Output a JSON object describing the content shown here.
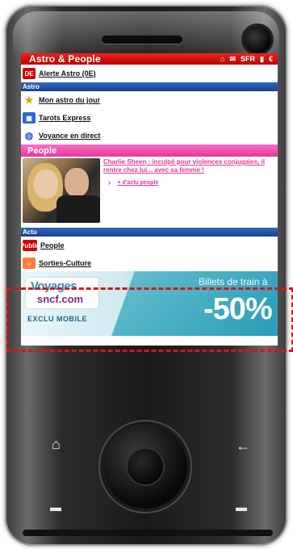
{
  "app": {
    "title": "Astro & People"
  },
  "status": {
    "network": "SFR",
    "euro": "€"
  },
  "alerte": {
    "label": "Alerte Astro (0E)",
    "badge": "DE"
  },
  "sections": {
    "astro": "Astro",
    "people": "People",
    "actu": "Actu"
  },
  "astro_items": [
    {
      "label": "Mon astro du jour",
      "icon": "stars-icon"
    },
    {
      "label": "Tarots Express",
      "icon": "cards-icon"
    },
    {
      "label": "Voyance en direct",
      "icon": "crystal-ball-icon"
    }
  ],
  "people": {
    "headline": "Charlie Sheen : inculpé pour violences conjugales, il rentre chez lui... avec sa femme !",
    "more_link": "+ d'actu people"
  },
  "actu_items": [
    {
      "label": "People",
      "badge": "Public"
    },
    {
      "label": "Sorties-Culture"
    }
  ],
  "ad": {
    "logo_top": "Voyages",
    "logo_bottom": "sncf.com",
    "exclu": "EXCLU MOBILE",
    "headline": "Billets de train à",
    "discount": "-50%"
  },
  "colors": {
    "topbar_red": "#d40000",
    "section_blue": "#1a3f8a",
    "people_pink": "#e2389a",
    "ad_highlight": "#d9141b"
  }
}
